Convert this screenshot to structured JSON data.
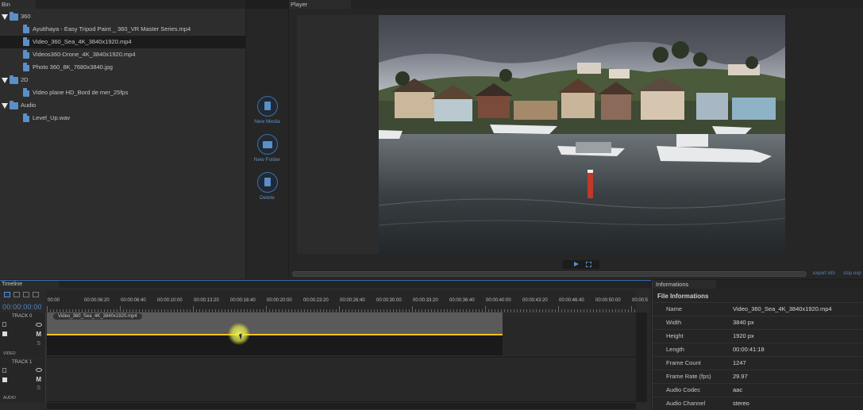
{
  "bin": {
    "title": "Bin",
    "items": [
      {
        "type": "folder",
        "label": "360"
      },
      {
        "type": "file",
        "label": "Ayutthaya - Easy Tripod Paint _ 360_VR Master Series.mp4"
      },
      {
        "type": "file",
        "label": "Video_360_Sea_4K_3840x1920.mp4",
        "selected": true
      },
      {
        "type": "file",
        "label": "Videos360-Drone_4K_3840x1920.mp4"
      },
      {
        "type": "file",
        "label": "Photo 360_8K_7680x3840.jpg"
      },
      {
        "type": "folder",
        "label": "2D"
      },
      {
        "type": "file",
        "label": "Video plane HD_Bord de mer_25fps"
      },
      {
        "type": "folder",
        "label": "Audio"
      },
      {
        "type": "file",
        "label": "Level_Up.wav"
      }
    ]
  },
  "side_buttons": {
    "new_media": "New Media",
    "new_folder": "New Folder",
    "delete": "Delete"
  },
  "player": {
    "title": "Player",
    "export_label": "export info",
    "stop_label": "stop exp"
  },
  "timeline": {
    "title": "Timeline",
    "timecode": "00:00:00:00",
    "ruler_ticks": [
      "00:00",
      "00:00:06:20",
      "00:00:06:40",
      "00:00:10:00",
      "00:00:13:20",
      "00:00:16:40",
      "00:00:20:00",
      "00:00:23:20",
      "00:00:26:40",
      "00:00:30:00",
      "00:00:33:20",
      "00:00:36:40",
      "00:00:40:00",
      "00:00:43:20",
      "00:00:46:40",
      "00:00:50:00",
      "00:00:5"
    ],
    "tracks": [
      {
        "name": "TRACK 0",
        "mute": "M",
        "solo": "S",
        "type": "VIDEO"
      },
      {
        "name": "TRACK 1",
        "mute": "M",
        "solo": "S",
        "type": "AUDIO"
      }
    ],
    "clip_name": "Video_360_Sea_4K_3840x1920.mp4",
    "accent_color": "#f4c21a"
  },
  "info": {
    "title": "Informations",
    "section": "File Informations",
    "rows": [
      {
        "key": "Name",
        "value": "Video_360_Sea_4K_3840x1920.mp4"
      },
      {
        "key": "Width",
        "value": "3840 px"
      },
      {
        "key": "Height",
        "value": "1920 px"
      },
      {
        "key": "Length",
        "value": "00:00:41:18"
      },
      {
        "key": "Frame Count",
        "value": "1247"
      },
      {
        "key": "Frame Rate (fps)",
        "value": "29.97"
      },
      {
        "key": "Audio Codec",
        "value": "aac"
      },
      {
        "key": "Audio Channel",
        "value": "stereo"
      }
    ]
  }
}
